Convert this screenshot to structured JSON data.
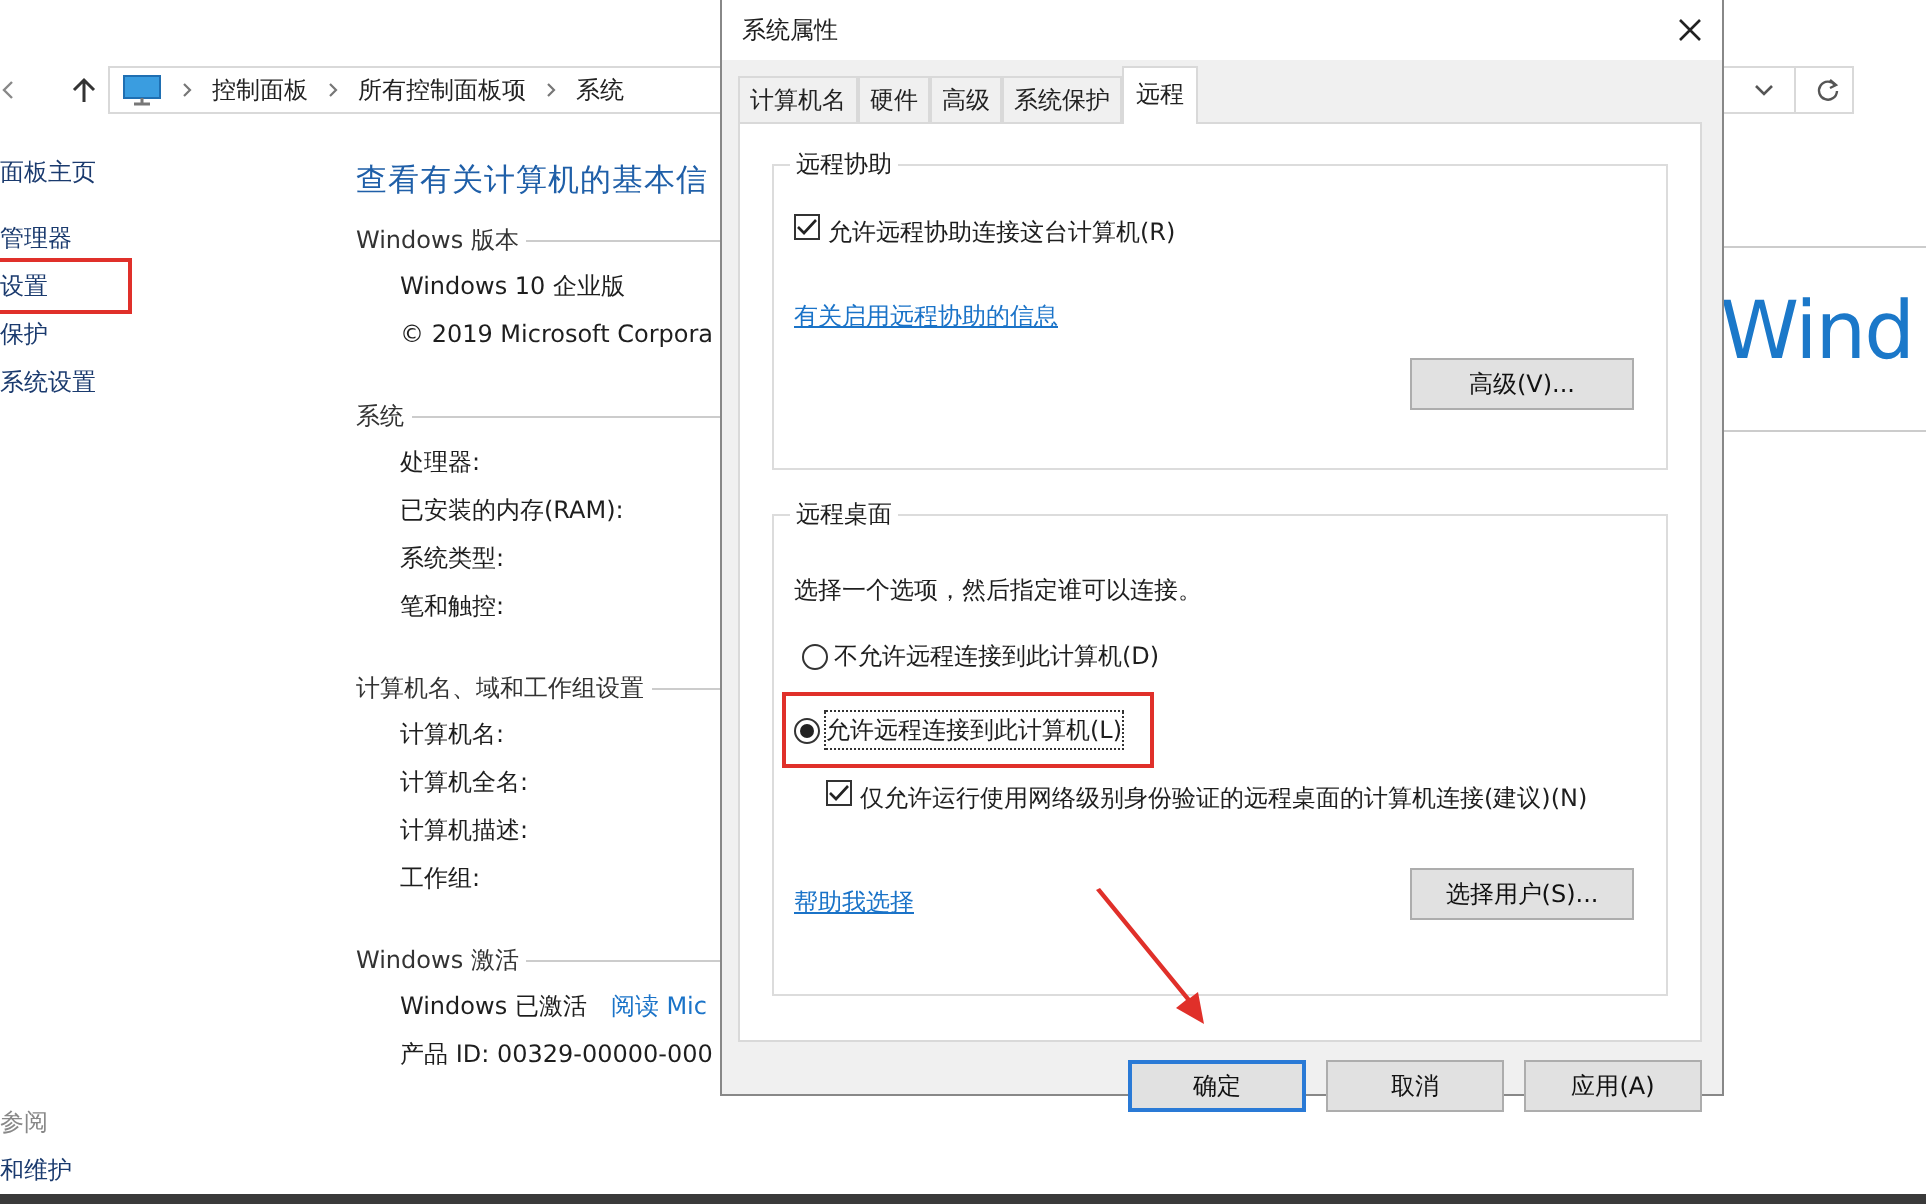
{
  "explorer": {
    "breadcrumbs": [
      "控制面板",
      "所有控制面板项",
      "系统"
    ],
    "sidebar": {
      "items": [
        {
          "label": "面板主页",
          "highlighted": false
        },
        {
          "label": "管理器",
          "highlighted": false
        },
        {
          "label": "设置",
          "highlighted": true
        },
        {
          "label": "保护",
          "highlighted": false
        },
        {
          "label": "系统设置",
          "highlighted": false
        }
      ],
      "see_also_title": "参阅",
      "see_also": [
        "和维护"
      ]
    },
    "main": {
      "title": "查看有关计算机的基本信",
      "sections": [
        {
          "heading": "Windows 版本",
          "rows": [
            {
              "text": "Windows 10 企业版"
            },
            {
              "text": "© 2019 Microsoft Corpora"
            }
          ]
        },
        {
          "heading": "系统",
          "rows": [
            {
              "text": "处理器:"
            },
            {
              "text": "已安装的内存(RAM):"
            },
            {
              "text": "系统类型:"
            },
            {
              "text": "笔和触控:"
            }
          ]
        },
        {
          "heading": "计算机名、域和工作组设置",
          "rows": [
            {
              "text": "计算机名:"
            },
            {
              "text": "计算机全名:"
            },
            {
              "text": "计算机描述:"
            },
            {
              "text": "工作组:"
            }
          ]
        },
        {
          "heading": "Windows 激活",
          "rows": [
            {
              "text": "Windows 已激活",
              "link": "阅读 Mic"
            },
            {
              "text": "产品 ID: 00329-00000-000"
            }
          ]
        }
      ]
    },
    "logo_text": "Wind"
  },
  "dialog": {
    "title": "系统属性",
    "tabs": [
      {
        "label": "计算机名",
        "selected": false
      },
      {
        "label": "硬件",
        "selected": false
      },
      {
        "label": "高级",
        "selected": false
      },
      {
        "label": "系统保护",
        "selected": false
      },
      {
        "label": "远程",
        "selected": true
      }
    ],
    "assistance": {
      "title": "远程协助",
      "checkbox": {
        "label": "允许远程协助连接这台计算机(R)",
        "checked": true
      },
      "link": "有关启用远程协助的信息",
      "button": "高级(V)..."
    },
    "desktop": {
      "title": "远程桌面",
      "instruction": "选择一个选项，然后指定谁可以连接。",
      "options": [
        {
          "label": "不允许远程连接到此计算机(D)",
          "selected": false,
          "highlighted": false
        },
        {
          "label": "允许远程连接到此计算机(L)",
          "selected": true,
          "highlighted": true
        }
      ],
      "nla": {
        "label": "仅允许运行使用网络级别身份验证的远程桌面的计算机连接(建议)(N)",
        "checked": true
      },
      "link": "帮助我选择",
      "button": "选择用户(S)..."
    },
    "buttons": [
      {
        "label": "确定",
        "default": true
      },
      {
        "label": "取消",
        "default": false
      },
      {
        "label": "应用(A)",
        "default": false
      }
    ]
  }
}
